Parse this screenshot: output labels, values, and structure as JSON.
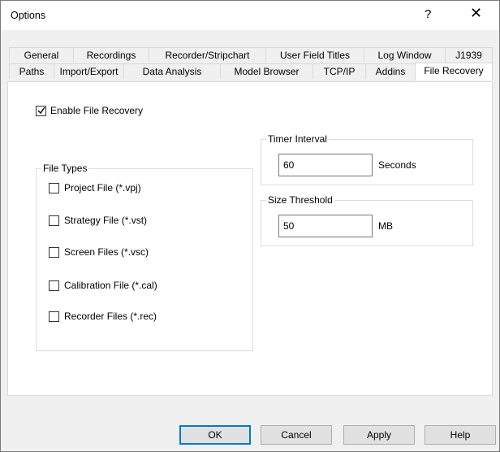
{
  "window": {
    "title": "Options",
    "help_glyph": "?",
    "close_glyph": "✕"
  },
  "tabs_row1": [
    {
      "label": "General"
    },
    {
      "label": "Recordings"
    },
    {
      "label": "Recorder/Stripchart"
    },
    {
      "label": "User Field Titles"
    },
    {
      "label": "Log Window"
    },
    {
      "label": "J1939"
    }
  ],
  "tabs_row2": [
    {
      "label": "Paths"
    },
    {
      "label": "Import/Export"
    },
    {
      "label": "Data Analysis"
    },
    {
      "label": "Model Browser"
    },
    {
      "label": "TCP/IP"
    },
    {
      "label": "Addins"
    },
    {
      "label": "File Recovery",
      "active": true
    }
  ],
  "recovery": {
    "enable_label": "Enable File Recovery",
    "enable_checked": true
  },
  "file_types": {
    "title": "File Types",
    "items": [
      {
        "label": "Project File (*.vpj)",
        "checked": false
      },
      {
        "label": "Strategy File (*.vst)",
        "checked": false
      },
      {
        "label": "Screen Files (*.vsc)",
        "checked": false
      },
      {
        "label": "Calibration File (*.cal)",
        "checked": false
      },
      {
        "label": "Recorder Files (*.rec)",
        "checked": false
      }
    ]
  },
  "timer": {
    "title": "Timer Interval",
    "value": "60",
    "unit": "Seconds"
  },
  "size": {
    "title": "Size Threshold",
    "value": "50",
    "unit": "MB"
  },
  "buttons": {
    "ok": "OK",
    "cancel": "Cancel",
    "apply": "Apply",
    "help": "Help"
  },
  "colors": {
    "default_button_border": "#0078d7",
    "dialog_background": "#f0f0f0"
  }
}
